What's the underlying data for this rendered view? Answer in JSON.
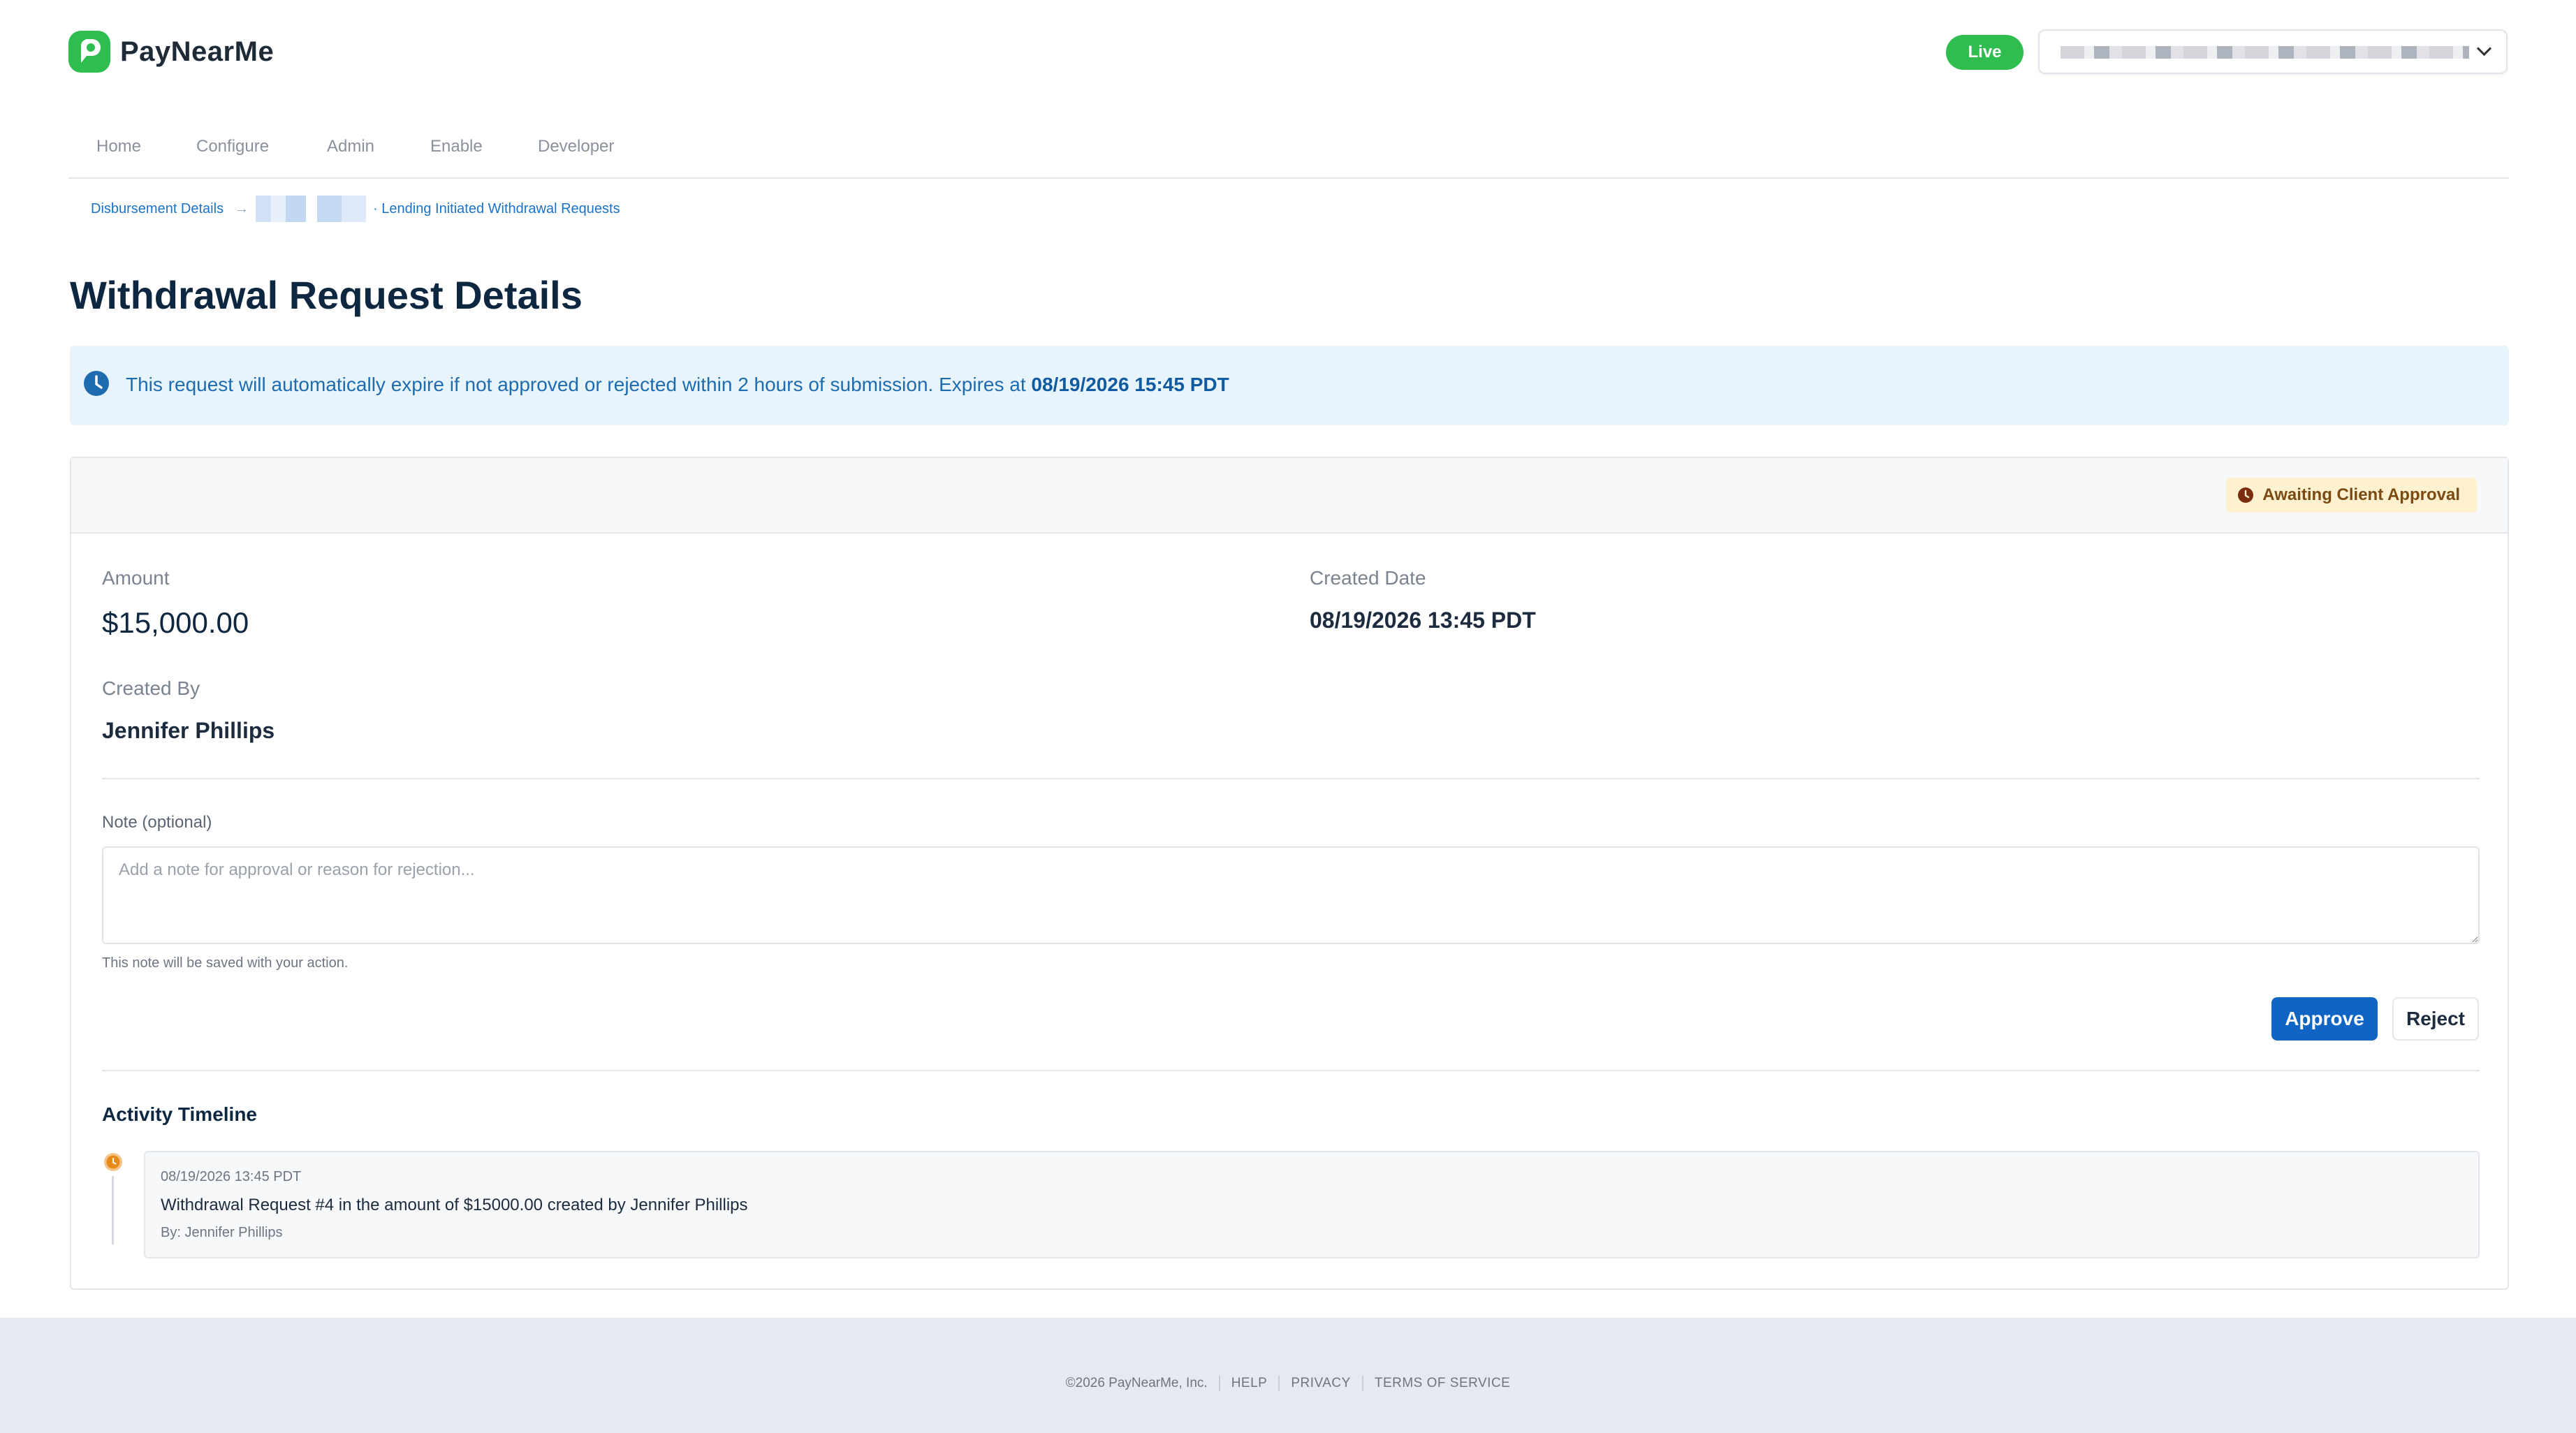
{
  "brand": {
    "name": "PayNearMe",
    "color": "#2ebd4e"
  },
  "header": {
    "environment_badge": "Live"
  },
  "nav": {
    "items": [
      "Home",
      "Configure",
      "Admin",
      "Enable",
      "Developer"
    ]
  },
  "breadcrumb": {
    "first": "Disbursement Details",
    "separator": "→",
    "last": "· Lending Initiated Withdrawal Requests"
  },
  "page": {
    "title": "Withdrawal Request Details"
  },
  "alert": {
    "text": "This request will automatically expire if not approved or rejected within 2 hours of submission. Expires at",
    "expires_at": "08/19/2026 15:45 PDT",
    "icon": "clock-icon"
  },
  "request": {
    "status": "Awaiting Client Approval",
    "amount_label": "Amount",
    "amount": "$15,000.00",
    "created_date_label": "Created Date",
    "created_date": "08/19/2026 13:45 PDT",
    "created_by_label": "Created By",
    "created_by": "Jennifer Phillips"
  },
  "note": {
    "label": "Note (optional)",
    "placeholder": "Add a note for approval or reason for rejection...",
    "value": "",
    "help": "This note will be saved with your action."
  },
  "actions": {
    "approve_label": "Approve",
    "reject_label": "Reject"
  },
  "timeline": {
    "title": "Activity Timeline",
    "entries": [
      {
        "time": "08/19/2026 13:45 PDT",
        "message": "Withdrawal Request #4 in the amount of $15000.00 created by Jennifer Phillips",
        "by": "By: Jennifer Phillips"
      }
    ]
  },
  "footer": {
    "copyright": "©2026 PayNearMe, Inc.",
    "links": [
      "HELP",
      "PRIVACY",
      "TERMS OF SERVICE"
    ]
  },
  "colors": {
    "primary": "#0f64c4",
    "live": "#2ebd4e",
    "alert_bg": "#e8f4fc",
    "status_bg": "#fdf1cf",
    "timeline_dot": "#e88a1a"
  }
}
